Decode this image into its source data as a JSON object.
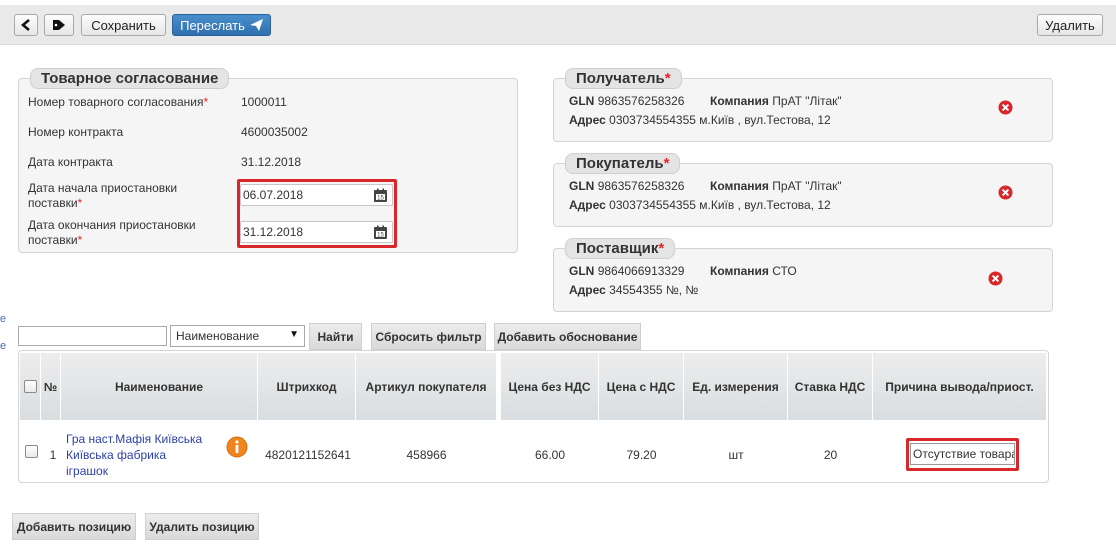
{
  "toolbar": {
    "save_label": "Сохранить",
    "forward_label": "Переслать",
    "delete_label": "Удалить"
  },
  "left_edge": {
    "fragment_1": "e",
    "fragment_2": "e"
  },
  "agreement": {
    "legend": "Товарное согласование",
    "number_label": "Номер товарного согласования",
    "number_value": "1000011",
    "contract_number_label": "Номер контракта",
    "contract_number_value": "4600035002",
    "contract_date_label": "Дата контракта",
    "contract_date_value": "31.12.2018",
    "suspend_start_label_1": "Дата начала приостановки",
    "suspend_start_label_2": "поставки",
    "suspend_start_value": "06.07.2018",
    "suspend_end_label_1": "Дата окончания приостановки",
    "suspend_end_label_2": "поставки",
    "suspend_end_value": "31.12.2018",
    "required_mark": "*"
  },
  "recipient": {
    "legend": "Получатель",
    "gln_label": "GLN",
    "gln_value": "9863576258326",
    "company_label": "Компания",
    "company_value": "ПрАТ \"Літак\"",
    "address_label": "Адрес",
    "address_value": "0303734554355 м.Київ , вул.Тестова, 12"
  },
  "buyer": {
    "legend": "Покупатель",
    "gln_label": "GLN",
    "gln_value": "9863576258326",
    "company_label": "Компания",
    "company_value": "ПрАТ \"Літак\"",
    "address_label": "Адрес",
    "address_value": "0303734554355 м.Київ , вул.Тестова, 12"
  },
  "supplier": {
    "legend": "Поставщик",
    "gln_label": "GLN",
    "gln_value": "9864066913329",
    "company_label": "Компания",
    "company_value": "СТО",
    "address_label": "Адрес",
    "address_value": "34554355 №, №"
  },
  "filter": {
    "search_value": "",
    "field_selected": "Наименование",
    "find_label": "Найти",
    "reset_label": "Сбросить фильтр",
    "add_reason_label": "Добавить обоснование"
  },
  "table": {
    "columns": [
      "№",
      "Наименование",
      "Штрихкод",
      "Артикул покупателя",
      "Цена без НДС",
      "Цена с НДС",
      "Ед. измерения",
      "Ставка НДС",
      "Причина вывода/приост."
    ],
    "rows": [
      {
        "num": "1",
        "name_line_1": "Гра наст.Мафія Київська",
        "name_line_2": "Київська фабрика",
        "name_line_3": "іграшок",
        "barcode": "4820121152641",
        "buyer_article": "458966",
        "price_no_vat": "66.00",
        "price_vat": "79.20",
        "unit": "шт",
        "vat_rate": "20",
        "reason": "Отсутствие товара"
      }
    ]
  },
  "footer": {
    "add_position_label": "Добавить позицию",
    "delete_position_label": "Удалить позицию"
  },
  "colors": {
    "accent": "#2f6fae",
    "highlight": "#d9262b",
    "remove": "#d9262b",
    "info": "#f0851d"
  }
}
